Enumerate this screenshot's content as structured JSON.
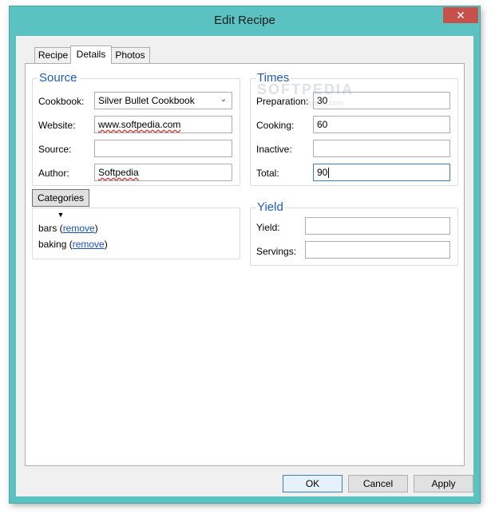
{
  "window": {
    "title": "Edit Recipe",
    "close_glyph": "✕"
  },
  "tabs": [
    {
      "label": "Recipe"
    },
    {
      "label": "Details"
    },
    {
      "label": "Photos"
    }
  ],
  "source": {
    "title": "Source",
    "cookbook_label": "Cookbook:",
    "cookbook_value": "Silver Bullet Cookbook",
    "website_label": "Website:",
    "website_value": "www.softpedia.com",
    "source_label": "Source:",
    "source_value": "",
    "author_label": "Author:",
    "author_value": "Softpedia"
  },
  "times": {
    "title": "Times",
    "preparation_label": "Preparation:",
    "preparation_value": "30",
    "cooking_label": "Cooking:",
    "cooking_value": "60",
    "inactive_label": "Inactive:",
    "inactive_value": "",
    "total_label": "Total:",
    "total_value": "90"
  },
  "categories": {
    "button_label": "Categories",
    "items": [
      {
        "name": "bars",
        "action": "remove"
      },
      {
        "name": "baking",
        "action": "remove"
      }
    ]
  },
  "yield": {
    "title": "Yield",
    "yield_label": "Yield:",
    "yield_value": "",
    "servings_label": "Servings:",
    "servings_value": ""
  },
  "buttons": {
    "ok": "OK",
    "cancel": "Cancel",
    "apply": "Apply"
  },
  "watermark": {
    "text": "SOFTPEDIA",
    "url": "www.softpedia.com"
  },
  "colors": {
    "frame": "#5bc2c2",
    "group_title": "#1e5bb8",
    "close": "#c7504b",
    "link": "#1a4fb5"
  }
}
